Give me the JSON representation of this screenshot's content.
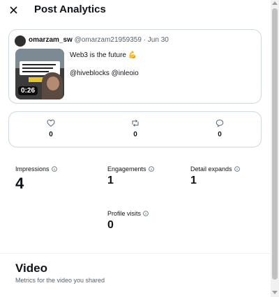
{
  "header": {
    "title": "Post Analytics",
    "close_icon": "close-icon"
  },
  "post": {
    "author_name": "omarzam_sw",
    "author_meta": "@omarzam21959359 · Jun 30",
    "text": "Web3 is the future 💪",
    "tags": "@hiveblocks @inleoio",
    "video_duration": "0:26"
  },
  "engagement": {
    "likes": {
      "icon": "heart-icon",
      "value": "0"
    },
    "reposts": {
      "icon": "repost-icon",
      "value": "0"
    },
    "replies": {
      "icon": "reply-icon",
      "value": "0"
    }
  },
  "metrics": {
    "impressions": {
      "label": "Impressions",
      "value": "4"
    },
    "engagements": {
      "label": "Engagements",
      "value": "1"
    },
    "detail_expands": {
      "label": "Detail expands",
      "value": "1"
    },
    "profile_visits": {
      "label": "Profile visits",
      "value": "0"
    }
  },
  "video_section": {
    "title": "Video",
    "subtitle": "Metrics for the video you shared"
  },
  "colors": {
    "text": "#0f1419",
    "muted": "#536471",
    "border": "#cfd9de"
  }
}
